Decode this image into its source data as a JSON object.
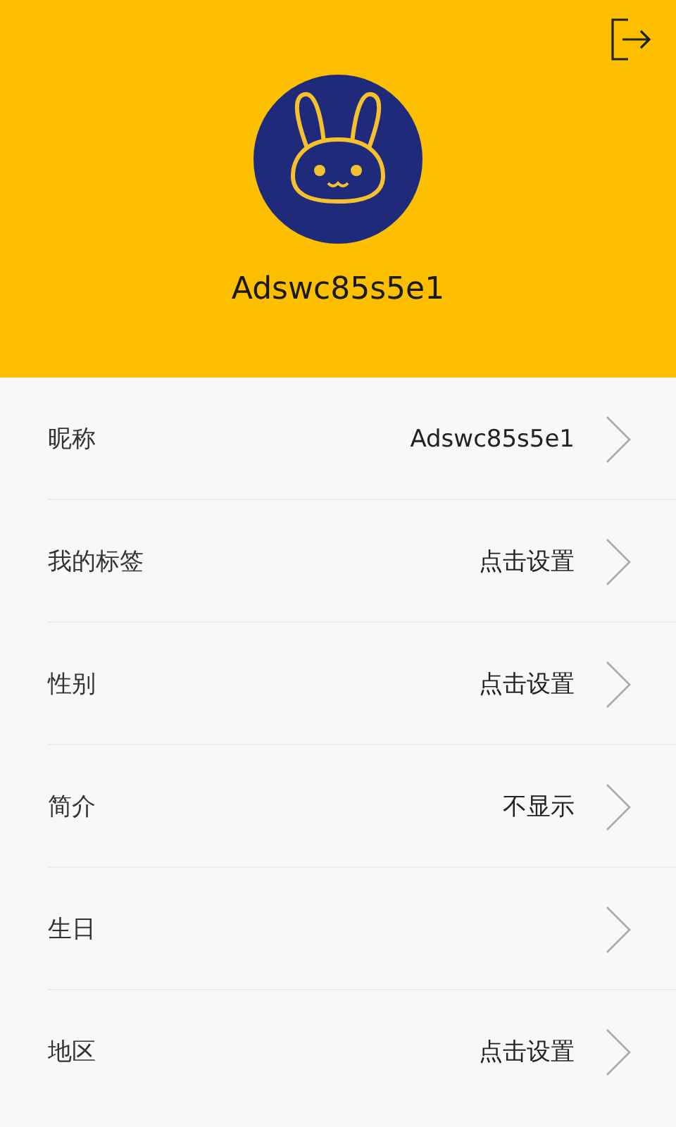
{
  "profile": {
    "username": "Adswc85s5e1"
  },
  "rows": [
    {
      "label": "昵称",
      "value": "Adswc85s5e1"
    },
    {
      "label": "我的标签",
      "value": "点击设置"
    },
    {
      "label": "性别",
      "value": "点击设置"
    },
    {
      "label": "简介",
      "value": "不显示"
    },
    {
      "label": "生日"
    },
    {
      "label": "地区",
      "value": "点击设置"
    }
  ]
}
